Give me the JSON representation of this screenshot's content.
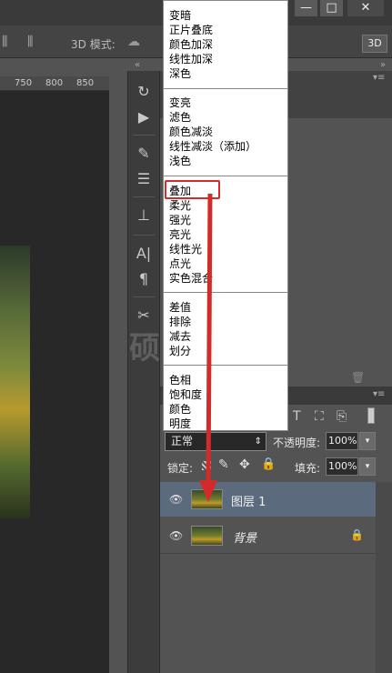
{
  "window": {
    "minimize": "—",
    "maximize": "□",
    "close": "✕"
  },
  "optbar": {
    "mode_label": "3D 模式:",
    "btn_3d": "3D"
  },
  "ruler": {
    "ticks": [
      "750",
      "800",
      "850"
    ]
  },
  "blend_menu": {
    "groups": [
      [
        "变暗",
        "正片叠底",
        "颜色加深",
        "线性加深",
        "深色"
      ],
      [
        "变亮",
        "滤色",
        "颜色减淡",
        "线性减淡（添加）",
        "浅色"
      ],
      [
        "叠加",
        "柔光",
        "强光",
        "亮光",
        "线性光",
        "点光",
        "实色混合"
      ],
      [
        "差值",
        "排除",
        "减去",
        "划分"
      ],
      [
        "色相",
        "饱和度",
        "颜色",
        "明度"
      ]
    ],
    "highlighted": "叠加"
  },
  "layers_panel": {
    "blend_mode": "正常",
    "opacity_label": "不透明度:",
    "opacity_value": "100%",
    "lock_label": "锁定:",
    "fill_label": "填充:",
    "fill_value": "100%",
    "layers": [
      {
        "name": "图层 1",
        "selected": true
      },
      {
        "name": "背景",
        "locked": true
      }
    ]
  },
  "watermark": "硕",
  "colors": {
    "accent_highlight": "#d32b2b",
    "selected_layer": "#5b6a7d",
    "panel_bg": "#535353"
  },
  "icons": [
    "visibility-eye-icon",
    "lock-icon",
    "text-icon",
    "transform-icon",
    "smart-object-icon",
    "brush-icon",
    "move-icon",
    "paragraph-icon",
    "character-icon",
    "history-icon",
    "play-icon",
    "adjustments-icon",
    "trash-icon"
  ]
}
